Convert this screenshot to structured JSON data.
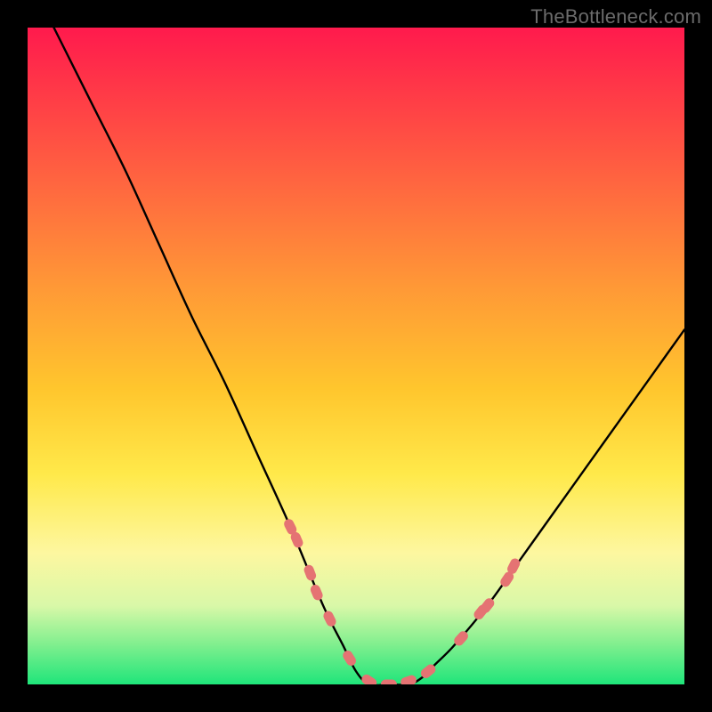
{
  "watermark": "TheBottleneck.com",
  "colors": {
    "frame": "#000000",
    "curve": "#000000",
    "dots": "#e57373"
  },
  "chart_data": {
    "type": "line",
    "title": "",
    "xlabel": "",
    "ylabel": "",
    "xlim": [
      0,
      100
    ],
    "ylim": [
      0,
      100
    ],
    "grid": false,
    "legend": false,
    "note": "V-shaped bottleneck curve over a vertical spectral gradient. Values are estimated from pixel positions; axes are unlabeled (0–100 normalized).",
    "series": [
      {
        "name": "bottleneck-curve",
        "x": [
          0,
          5,
          10,
          15,
          20,
          25,
          30,
          35,
          40,
          45,
          48,
          50,
          52,
          55,
          58,
          60,
          62,
          65,
          70,
          75,
          80,
          85,
          90,
          95,
          100
        ],
        "y": [
          108,
          98,
          88,
          78,
          67,
          56,
          46,
          35,
          24,
          12,
          6,
          2,
          0,
          0,
          0,
          1,
          3,
          6,
          12,
          19,
          26,
          33,
          40,
          47,
          54
        ]
      }
    ],
    "highlight_dots": {
      "name": "salmon-dot-band",
      "note": "Dashed salmon capsule segments along the curve near the trough.",
      "points": [
        {
          "x": 40,
          "y": 24
        },
        {
          "x": 41,
          "y": 22
        },
        {
          "x": 43,
          "y": 17
        },
        {
          "x": 44,
          "y": 14
        },
        {
          "x": 46,
          "y": 10
        },
        {
          "x": 49,
          "y": 4
        },
        {
          "x": 52,
          "y": 0.5
        },
        {
          "x": 55,
          "y": 0
        },
        {
          "x": 58,
          "y": 0.5
        },
        {
          "x": 61,
          "y": 2
        },
        {
          "x": 66,
          "y": 7
        },
        {
          "x": 69,
          "y": 11
        },
        {
          "x": 70,
          "y": 12
        },
        {
          "x": 73,
          "y": 16
        },
        {
          "x": 74,
          "y": 18
        }
      ]
    }
  }
}
